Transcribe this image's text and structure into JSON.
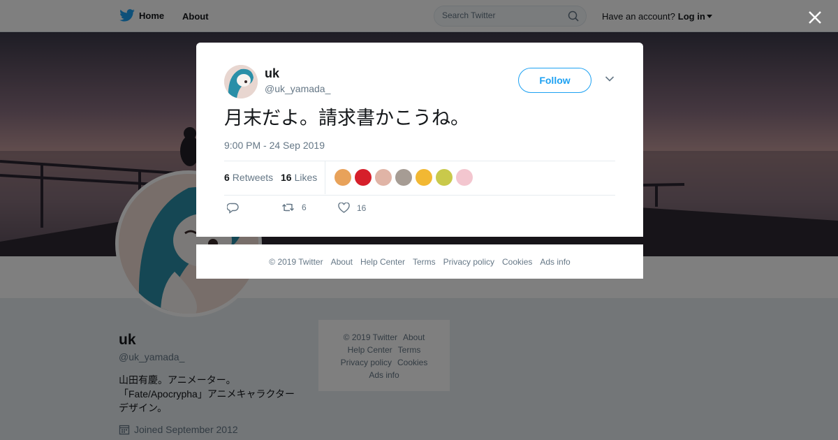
{
  "topbar": {
    "home_label": "Home",
    "about_label": "About",
    "search_placeholder": "Search Twitter",
    "have_account": "Have an account?",
    "login_label": "Log in"
  },
  "profile": {
    "name": "uk",
    "handle": "@uk_yamada_",
    "bio_lines": [
      "山田有慶。アニメーター。",
      "「Fate/Apocrypha」アニメキャラクター",
      "デザイン。"
    ],
    "joined": "Joined September 2012"
  },
  "side_footer": {
    "copyright": "© 2019 Twitter",
    "about": "About",
    "help": "Help Center",
    "terms": "Terms",
    "privacy": "Privacy policy",
    "cookies": "Cookies",
    "ads": "Ads info"
  },
  "tweet": {
    "name": "uk",
    "handle": "@uk_yamada_",
    "follow_label": "Follow",
    "text": "月末だよ。請求書かこうね。",
    "timestamp": "9:00 PM - 24 Sep 2019",
    "retweets_count": "6",
    "retweets_label": "Retweets",
    "likes_count": "16",
    "likes_label": "Likes",
    "action_retweet_count": "6",
    "action_like_count": "16",
    "liker_colors": [
      "#e8a25a",
      "#d61f2a",
      "#e0b4a6",
      "#a69c94",
      "#f2b833",
      "#c9c94b",
      "#f3c6cf"
    ]
  },
  "modal_footer": {
    "copyright": "© 2019 Twitter",
    "about": "About",
    "help": "Help Center",
    "terms": "Terms",
    "privacy": "Privacy policy",
    "cookies": "Cookies",
    "ads": "Ads info"
  },
  "colors": {
    "brand": "#1da1f2",
    "text_secondary": "#657786"
  }
}
